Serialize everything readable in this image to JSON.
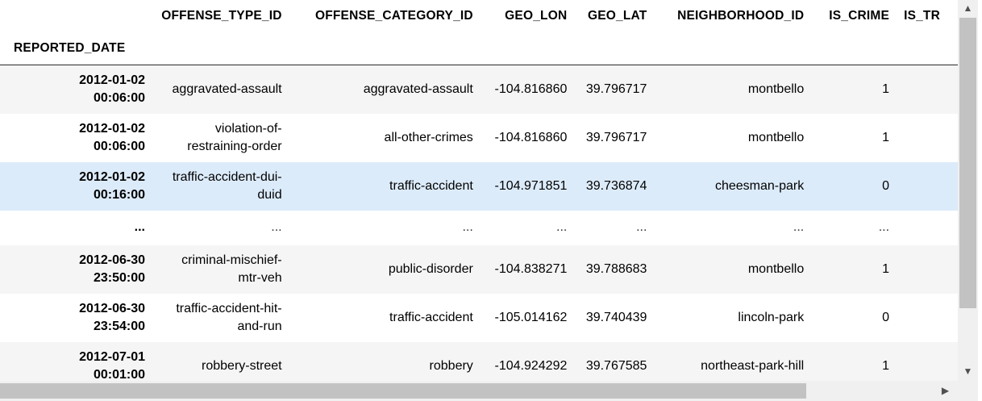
{
  "columns": {
    "offense_type_id": "OFFENSE_TYPE_ID",
    "offense_category_id": "OFFENSE_CATEGORY_ID",
    "geo_lon": "GEO_LON",
    "geo_lat": "GEO_LAT",
    "neighborhood_id": "NEIGHBORHOOD_ID",
    "is_crime": "IS_CRIME",
    "is_traffic_partial": "IS_TR"
  },
  "index_name": "REPORTED_DATE",
  "rows": [
    {
      "date": "2012-01-02",
      "time": "00:06:00",
      "offense_type": [
        "aggravated-assault"
      ],
      "offense_category": "aggravated-assault",
      "geo_lon": "-104.816860",
      "geo_lat": "39.796717",
      "neighborhood": "montbello",
      "is_crime": "1"
    },
    {
      "date": "2012-01-02",
      "time": "00:06:00",
      "offense_type": [
        "violation-of-",
        "restraining-order"
      ],
      "offense_category": "all-other-crimes",
      "geo_lon": "-104.816860",
      "geo_lat": "39.796717",
      "neighborhood": "montbello",
      "is_crime": "1"
    },
    {
      "date": "2012-01-02",
      "time": "00:16:00",
      "offense_type": [
        "traffic-accident-dui-",
        "duid"
      ],
      "offense_category": "traffic-accident",
      "geo_lon": "-104.971851",
      "geo_lat": "39.736874",
      "neighborhood": "cheesman-park",
      "is_crime": "0"
    },
    {
      "ellipsis": "...",
      "ellipsis_index": "..."
    },
    {
      "date": "2012-06-30",
      "time": "23:50:00",
      "offense_type": [
        "criminal-mischief-",
        "mtr-veh"
      ],
      "offense_category": "public-disorder",
      "geo_lon": "-104.838271",
      "geo_lat": "39.788683",
      "neighborhood": "montbello",
      "is_crime": "1"
    },
    {
      "date": "2012-06-30",
      "time": "23:54:00",
      "offense_type": [
        "traffic-accident-hit-",
        "and-run"
      ],
      "offense_category": "traffic-accident",
      "geo_lon": "-105.014162",
      "geo_lat": "39.740439",
      "neighborhood": "lincoln-park",
      "is_crime": "0"
    },
    {
      "date": "2012-07-01",
      "time": "00:01:00",
      "offense_type": [
        "robbery-street"
      ],
      "offense_category": "robbery",
      "geo_lon": "-104.924292",
      "geo_lat": "39.767585",
      "neighborhood": "northeast-park-hill",
      "is_crime": "1"
    }
  ],
  "scrollbars": {
    "up_arrow": "▲",
    "down_arrow": "▼",
    "left_arrow": "◀",
    "right_arrow": "▶"
  }
}
